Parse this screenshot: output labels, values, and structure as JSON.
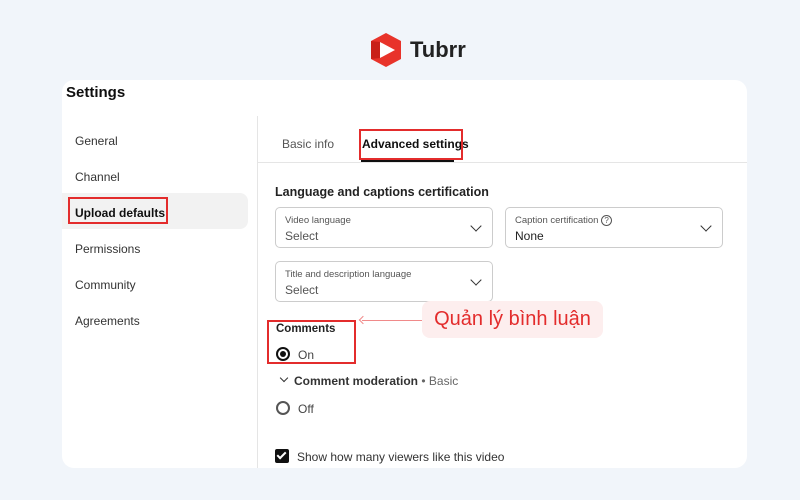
{
  "brand": {
    "name": "Tubrr",
    "logo_color": "#e8332a"
  },
  "page": {
    "title": "Settings"
  },
  "sidebar": {
    "items": [
      {
        "label": "General"
      },
      {
        "label": "Channel"
      },
      {
        "label": "Upload defaults",
        "active": true
      },
      {
        "label": "Permissions"
      },
      {
        "label": "Community"
      },
      {
        "label": "Agreements"
      }
    ]
  },
  "tabs": [
    {
      "label": "Basic info"
    },
    {
      "label": "Advanced settings",
      "active": true
    }
  ],
  "section": {
    "title": "Language and captions certification"
  },
  "fields": {
    "video_language": {
      "label": "Video language",
      "value": "Select"
    },
    "caption_certification": {
      "label": "Caption certification",
      "value": "None"
    },
    "title_language": {
      "label": "Title and description language",
      "value": "Select"
    }
  },
  "comments": {
    "title": "Comments",
    "on_label": "On",
    "off_label": "Off",
    "selected": "On",
    "moderation_label": "Comment moderation",
    "moderation_value": "• Basic"
  },
  "likes_checkbox": {
    "label": "Show how many viewers like this video",
    "checked": true
  },
  "callout": {
    "text": "Quản lý bình luận",
    "color": "#e32c2c"
  }
}
